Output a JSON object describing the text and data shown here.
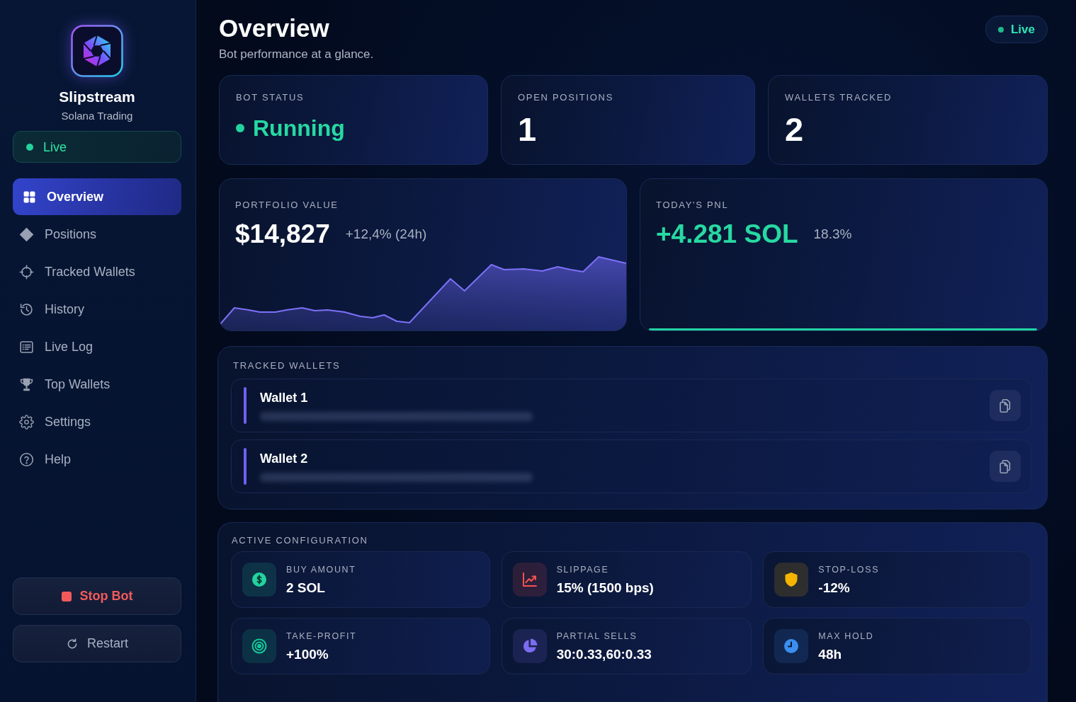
{
  "sidebar": {
    "brand": {
      "name": "Slipstream",
      "tagline": "Solana Trading"
    },
    "status": {
      "label": "Live",
      "on": true
    },
    "nav": [
      {
        "label": "Overview",
        "selected": true
      },
      {
        "label": "Positions",
        "selected": false
      },
      {
        "label": "Tracked Wallets",
        "selected": false
      },
      {
        "label": "History",
        "selected": false
      },
      {
        "label": "Live Log",
        "selected": false
      },
      {
        "label": "Top Wallets",
        "selected": false
      },
      {
        "label": "Settings",
        "selected": false
      },
      {
        "label": "Help",
        "selected": false
      }
    ],
    "buttons": [
      {
        "kind": "stop",
        "label": "Stop Bot"
      },
      {
        "kind": "restart",
        "label": "Restart"
      }
    ]
  },
  "header": {
    "title": "Overview",
    "subtitle": "Bot performance at a glance.",
    "status": {
      "label": "Live",
      "on": true
    }
  },
  "stats": [
    {
      "label": "BOT STATUS",
      "value": "Running",
      "kind": "status"
    },
    {
      "label": "OPEN POSITIONS",
      "value": "1",
      "kind": "number"
    },
    {
      "label": "WALLETS TRACKED",
      "value": "2",
      "kind": "number"
    }
  ],
  "portfolio": {
    "label": "PORTFOLIO VALUE",
    "value": "$14,827",
    "change": "+12,4% (24h)"
  },
  "pnl": {
    "label": "TODAY'S PNL",
    "value": "+4.281 SOL",
    "percent": "18.3%"
  },
  "tracked_wallets": {
    "title": "TRACKED WALLETS",
    "items": [
      {
        "name": "Wallet 1"
      },
      {
        "name": "Wallet 2"
      }
    ]
  },
  "configuration": {
    "title": "ACTIVE CONFIGURATION",
    "items": [
      {
        "label": "BUY AMOUNT",
        "value": "2 SOL",
        "color": "#22d3a0"
      },
      {
        "label": "SLIPPAGE",
        "value": "15% (1500 bps)",
        "color": "#ef5350"
      },
      {
        "label": "STOP-LOSS",
        "value": "-12%",
        "color": "#f5b400"
      },
      {
        "label": "TAKE-PROFIT",
        "value": "+100%",
        "color": "#14c99a"
      },
      {
        "label": "PARTIAL SELLS",
        "value": "30:0.33,60:0.33",
        "color": "#7c6cf0"
      },
      {
        "label": "MAX HOLD",
        "value": "48h",
        "color": "#3b8ef0"
      }
    ]
  }
}
